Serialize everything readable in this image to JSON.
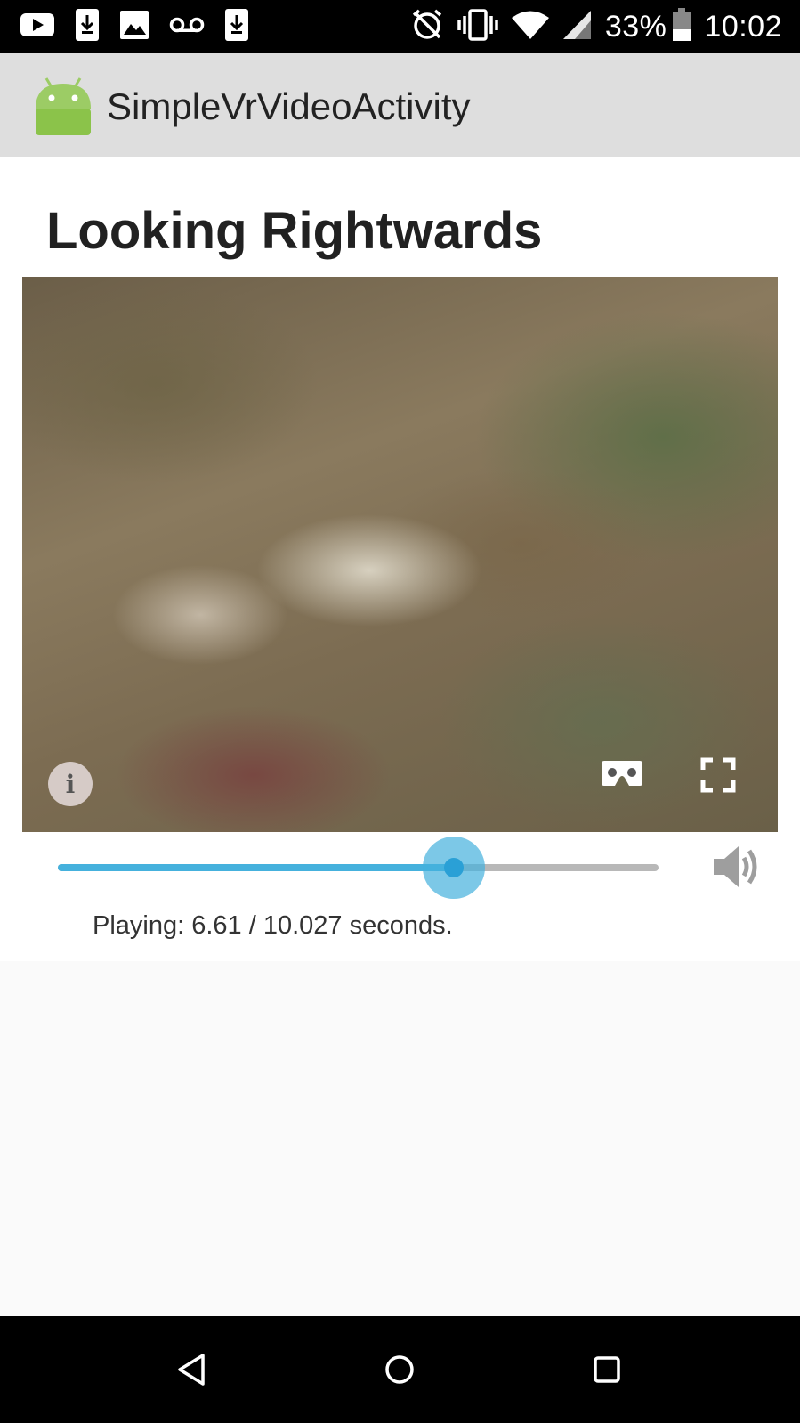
{
  "status_bar": {
    "battery_percent": "33%",
    "time": "10:02",
    "left_icons": [
      "youtube-icon",
      "download-icon",
      "image-icon",
      "voicemail-icon",
      "download-icon"
    ],
    "right_icons": [
      "alarm-off-icon",
      "vibrate-icon",
      "wifi-icon",
      "signal-icon",
      "battery-icon"
    ]
  },
  "action_bar": {
    "title": "SimpleVrVideoActivity",
    "icon": "android-icon"
  },
  "main": {
    "heading": "Looking Rightwards",
    "video": {
      "info_icon": "info-icon",
      "vr_icon": "cardboard-icon",
      "fullscreen_icon": "fullscreen-icon",
      "info_label": "i"
    },
    "seek": {
      "progress": 0.6592,
      "volume_icon": "volume-icon"
    },
    "status": "Playing: 6.61 / 10.027 seconds."
  },
  "nav_bar": {
    "back_icon": "back-icon",
    "home_icon": "home-icon",
    "recents_icon": "recents-icon"
  },
  "colors": {
    "accent": "#45b1dd",
    "action_bar": "#dedede",
    "android_green": "#9ccc65"
  }
}
